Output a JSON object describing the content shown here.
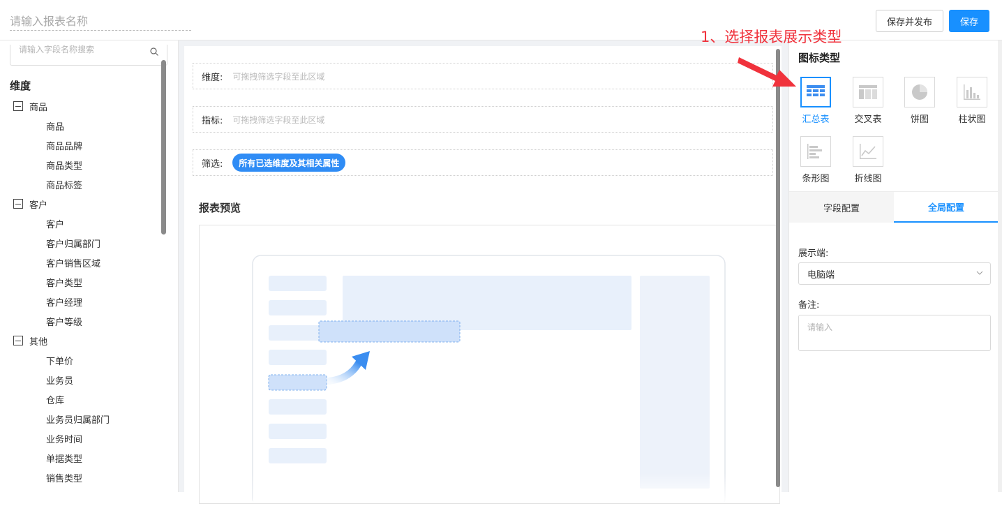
{
  "header": {
    "title_placeholder": "请输入报表名称",
    "publish_label": "保存并发布",
    "save_label": "保存"
  },
  "sidebar": {
    "search_placeholder": "请输入字段名称搜索",
    "section_title": "维度",
    "groups": [
      {
        "label": "商品",
        "items": [
          "商品",
          "商品品牌",
          "商品类型",
          "商品标签"
        ]
      },
      {
        "label": "客户",
        "items": [
          "客户",
          "客户归属部门",
          "客户销售区域",
          "客户类型",
          "客户经理",
          "客户等级"
        ]
      },
      {
        "label": "其他",
        "items": [
          "下单价",
          "业务员",
          "仓库",
          "业务员归属部门",
          "业务时间",
          "单据类型",
          "销售类型"
        ]
      }
    ]
  },
  "main": {
    "dimension_label": "维度:",
    "dimension_hint": "可拖拽筛选字段至此区域",
    "metric_label": "指标:",
    "metric_hint": "可拖拽筛选字段至此区域",
    "filter_label": "筛选:",
    "filter_tag": "所有已选维度及其相关属性",
    "preview_title": "报表预览"
  },
  "panel": {
    "chart_type_title": "图标类型",
    "chart_types": [
      {
        "label": "汇总表",
        "icon": "summary-table-icon",
        "active": true
      },
      {
        "label": "交叉表",
        "icon": "cross-table-icon",
        "active": false
      },
      {
        "label": "饼图",
        "icon": "pie-chart-icon",
        "active": false
      },
      {
        "label": "柱状图",
        "icon": "bar-chart-icon",
        "active": false
      },
      {
        "label": "条形图",
        "icon": "horizontal-bar-icon",
        "active": false
      },
      {
        "label": "折线图",
        "icon": "line-chart-icon",
        "active": false
      }
    ],
    "tab_field": "字段配置",
    "tab_global": "全局配置",
    "display_label": "展示端:",
    "display_value": "电脑端",
    "remark_label": "备注:",
    "remark_placeholder": "请输入"
  },
  "annotation": {
    "text": "1、选择报表展示类型"
  },
  "colors": {
    "accent": "#1890ff",
    "annotation": "#f0323c",
    "tag": "#2f8cf5"
  }
}
